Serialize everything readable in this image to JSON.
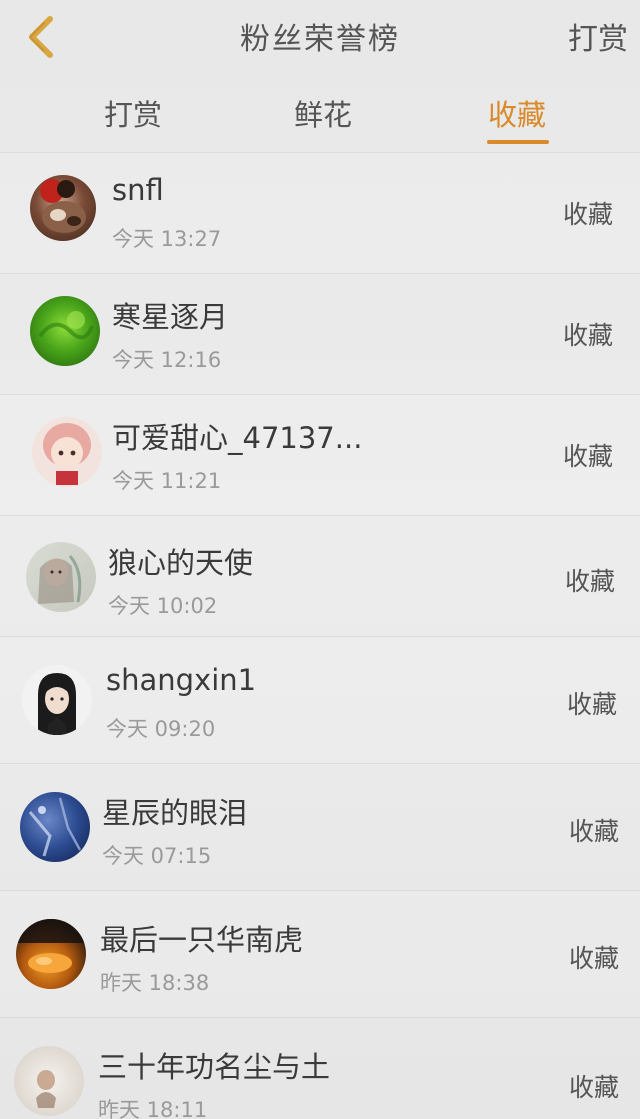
{
  "header": {
    "title": "粉丝荣誉榜",
    "action_label": "打赏"
  },
  "tabs": [
    {
      "label": "打赏",
      "active": false
    },
    {
      "label": "鲜花",
      "active": false
    },
    {
      "label": "收藏",
      "active": true
    }
  ],
  "colors": {
    "accent": "#d98a2b",
    "text": "#3a3a3a",
    "muted": "#9a9a9a"
  },
  "list": [
    {
      "name": "snfl",
      "time": "今天 13:27",
      "type": "收藏"
    },
    {
      "name": "寒星逐月",
      "time": "今天 12:16",
      "type": "收藏"
    },
    {
      "name": "可爱甜心_47137...",
      "time": "今天 11:21",
      "type": "收藏"
    },
    {
      "name": "狼心的天使",
      "time": "今天 10:02",
      "type": "收藏"
    },
    {
      "name": "shangxin1",
      "time": "今天 09:20",
      "type": "收藏"
    },
    {
      "name": "星辰的眼泪",
      "time": "今天 07:15",
      "type": "收藏"
    },
    {
      "name": "最后一只华南虎",
      "time": "昨天 18:38",
      "type": "收藏"
    },
    {
      "name": "三十年功名尘与土",
      "time": "昨天 18:11",
      "type": "收藏"
    }
  ]
}
